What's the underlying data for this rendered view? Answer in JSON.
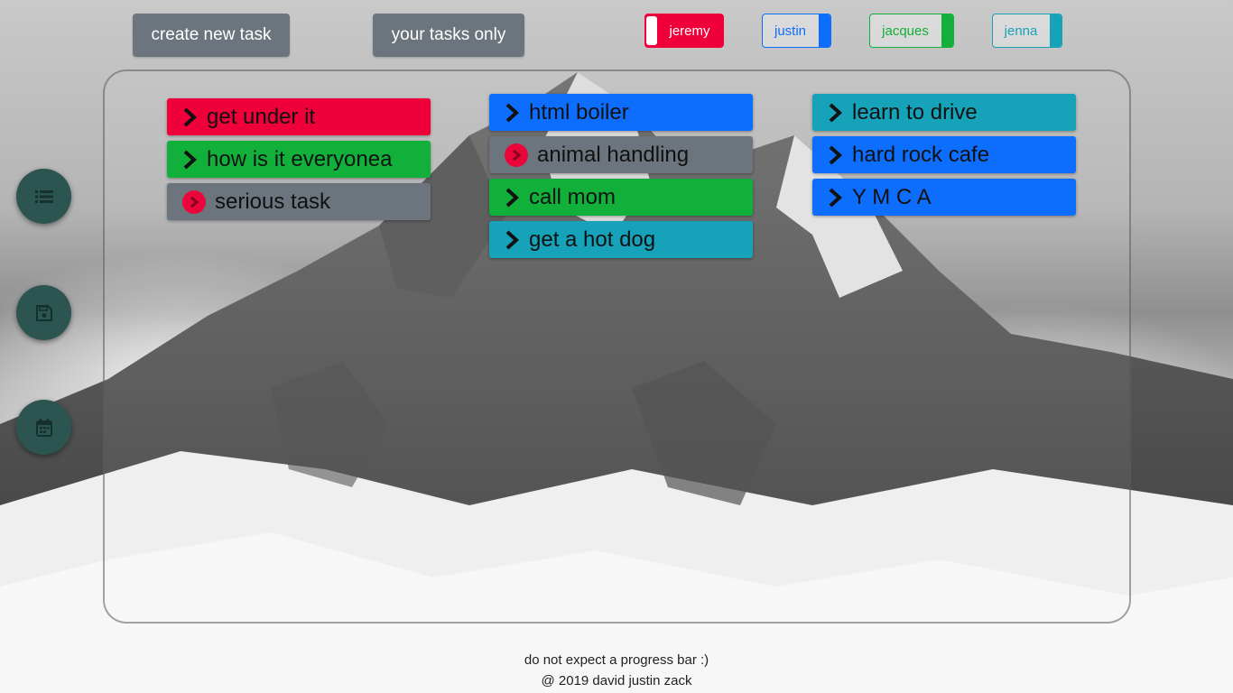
{
  "toolbar": {
    "create_label": "create new task",
    "your_tasks_label": "your tasks only"
  },
  "users": [
    {
      "name": "jeremy",
      "color": "#f0003a"
    },
    {
      "name": "justin",
      "color": "#0d6efd"
    },
    {
      "name": "jacques",
      "color": "#10b03a"
    },
    {
      "name": "jenna",
      "color": "#16a2b8"
    }
  ],
  "sidebar": {
    "icons": [
      "list-icon",
      "save-icon",
      "calendar-icon"
    ]
  },
  "columns": [
    {
      "tasks": [
        {
          "label": "get under it",
          "color": "red",
          "icon": "chevron-right-icon"
        },
        {
          "label": "how is it everyonea",
          "color": "green",
          "icon": "chevron-right-icon"
        },
        {
          "label": "serious task",
          "color": "gray",
          "icon": "alert-chevron-icon"
        }
      ]
    },
    {
      "tasks": [
        {
          "label": "html boiler",
          "color": "blue",
          "icon": "chevron-right-icon"
        },
        {
          "label": "animal handling",
          "color": "gray",
          "icon": "alert-chevron-icon"
        },
        {
          "label": "call mom",
          "color": "green",
          "icon": "chevron-right-icon"
        },
        {
          "label": "get a hot dog",
          "color": "teal",
          "icon": "chevron-right-icon"
        }
      ]
    },
    {
      "tasks": [
        {
          "label": "learn to drive",
          "color": "teal",
          "icon": "chevron-right-icon"
        },
        {
          "label": "hard rock cafe",
          "color": "blue",
          "icon": "chevron-right-icon"
        },
        {
          "label": "Y M C A",
          "color": "blue",
          "icon": "chevron-right-icon"
        }
      ]
    }
  ],
  "footer": {
    "line1": "do not expect a progress bar :)",
    "line2": "@ 2019 david justin zack"
  }
}
